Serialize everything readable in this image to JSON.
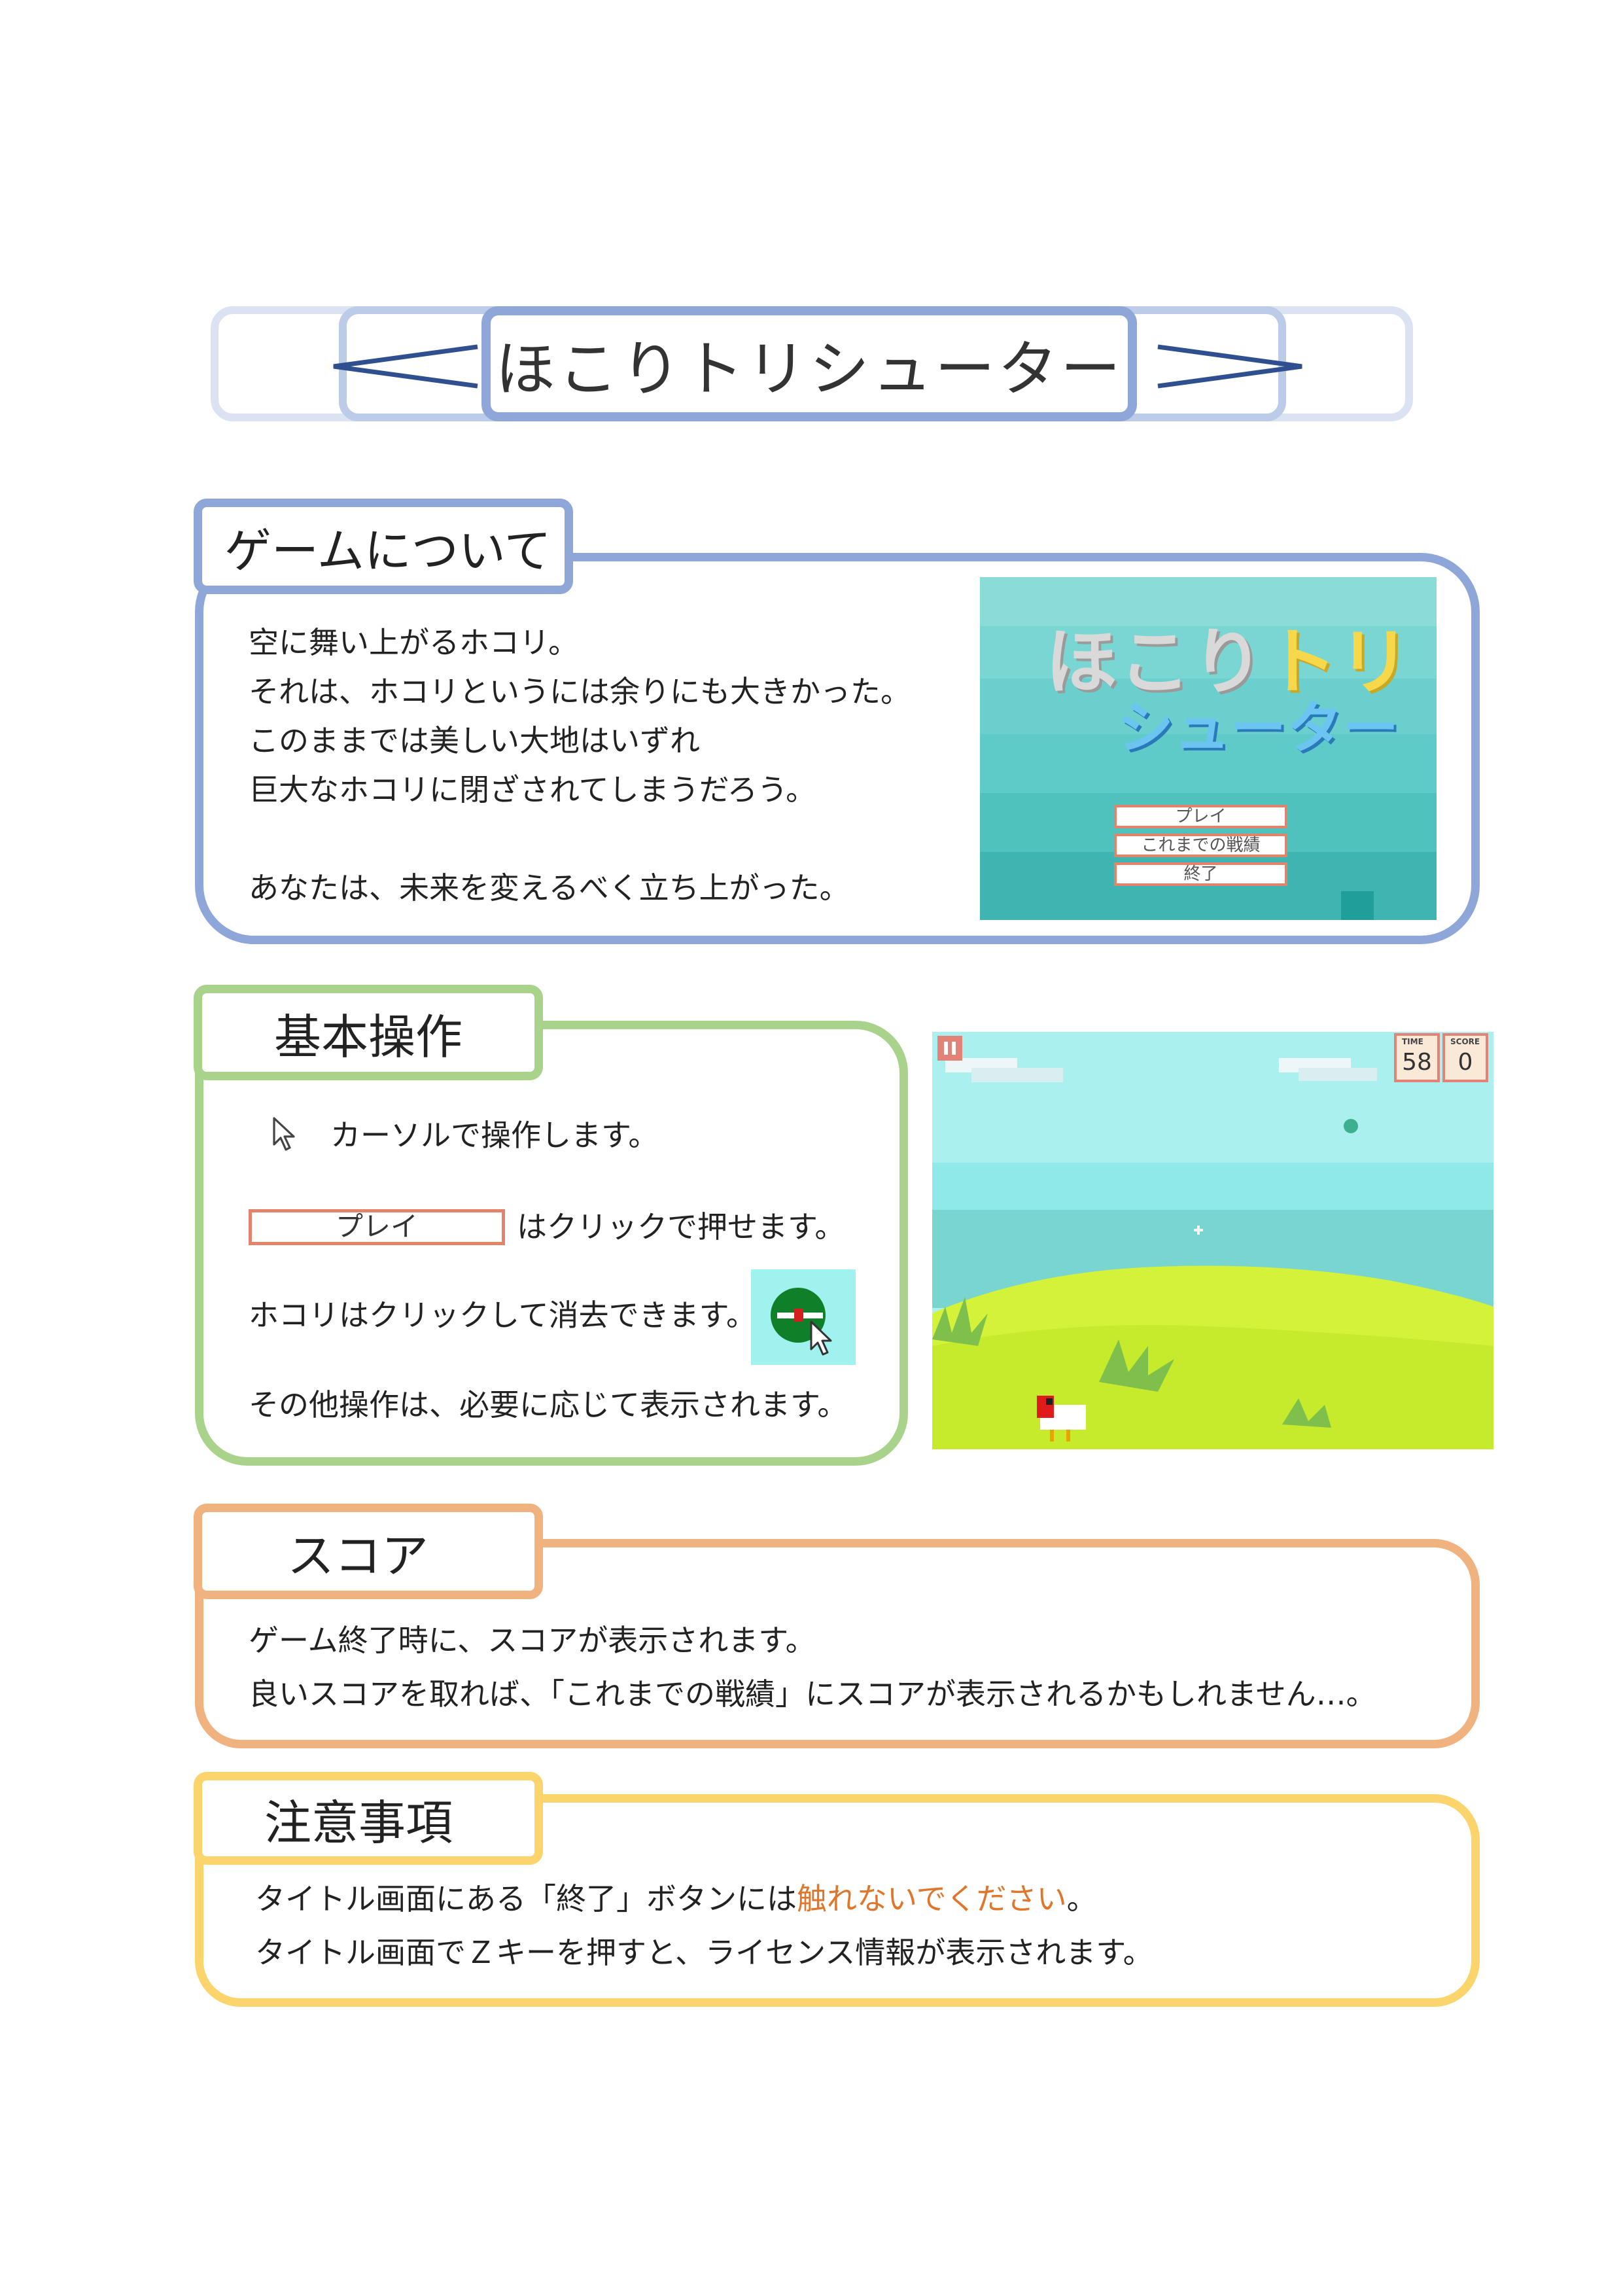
{
  "title": "ほこりトリシューター",
  "sections": {
    "about": {
      "heading": "ゲームについて",
      "lines": [
        "空に舞い上がるホコリ。",
        "それは、ホコリというには余りにも大きかった。",
        "このままでは美しい大地はいずれ",
        "巨大なホコリに閉ざされてしまうだろう。",
        "",
        "あなたは、未来を変えるべく立ち上がった。"
      ]
    },
    "controls": {
      "heading": "基本操作",
      "cursor_text": "カーソルで操作します。",
      "play_button_label": "プレイ",
      "play_text": "はクリックで押せます。",
      "dust_text": "ホコリはクリックして消去できます。",
      "other_text": "その他操作は、必要に応じて表示されます。"
    },
    "score": {
      "heading": "スコア",
      "line1": "ゲーム終了時に、スコアが表示されます。",
      "line2": "良いスコアを取れば、「これまでの戦績」にスコアが表示されるかもしれません…。"
    },
    "notes": {
      "heading": "注意事項",
      "line1_pre": "タイトル画面にある「終了」ボタンには",
      "line1_warn": "触れないでください",
      "line1_post": "。",
      "line2": "タイトル画面でＺキーを押すと、ライセンス情報が表示されます。",
      "warn_color": "#e0762b"
    }
  },
  "title_screen": {
    "logo_line1_a": "ほこり",
    "logo_line1_b": "トリ",
    "logo_line2": "シューター",
    "menu": [
      "プレイ",
      "これまでの戦績",
      "終了"
    ]
  },
  "game_screen": {
    "time_label": "TIME",
    "time_value": "58",
    "score_label": "SCORE",
    "score_value": "0",
    "pause_icon": "pause-icon"
  },
  "colors": {
    "about": "#8ea6d8",
    "controls": "#a9d28b",
    "score": "#f0b27f",
    "notes": "#fbd46c"
  }
}
